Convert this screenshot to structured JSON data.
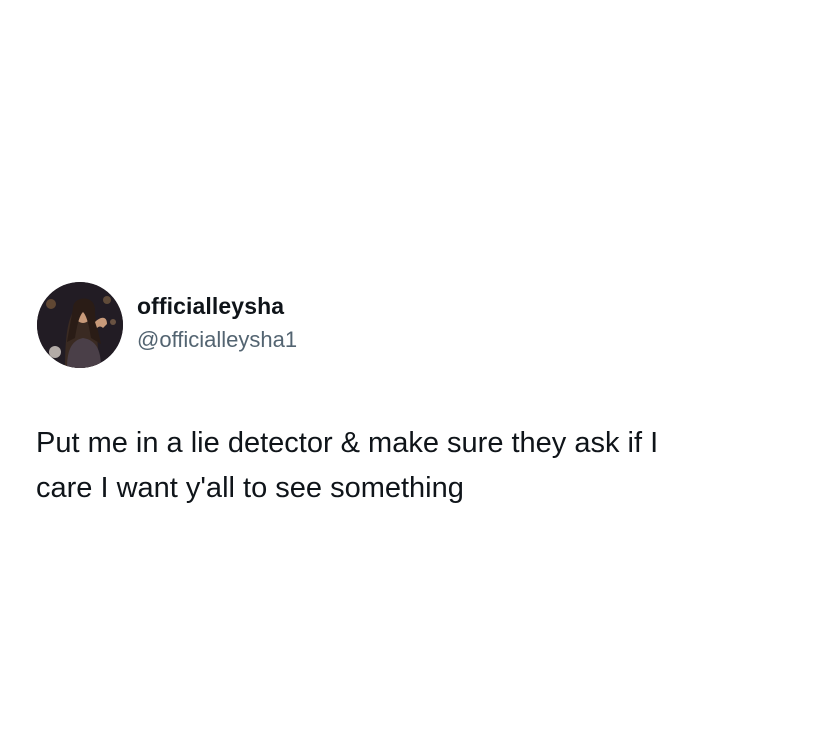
{
  "tweet": {
    "display_name": "officialleysha",
    "handle": "@officialleysha1",
    "text_line1": "Put me in a lie detector & make sure they ask if I",
    "text_line2": "care I want y'all to see something"
  },
  "avatar": {
    "icon": "profile-photo"
  },
  "colors": {
    "background": "#ffffff",
    "name": "#0f1419",
    "handle": "#536471",
    "text": "#0f1419"
  }
}
